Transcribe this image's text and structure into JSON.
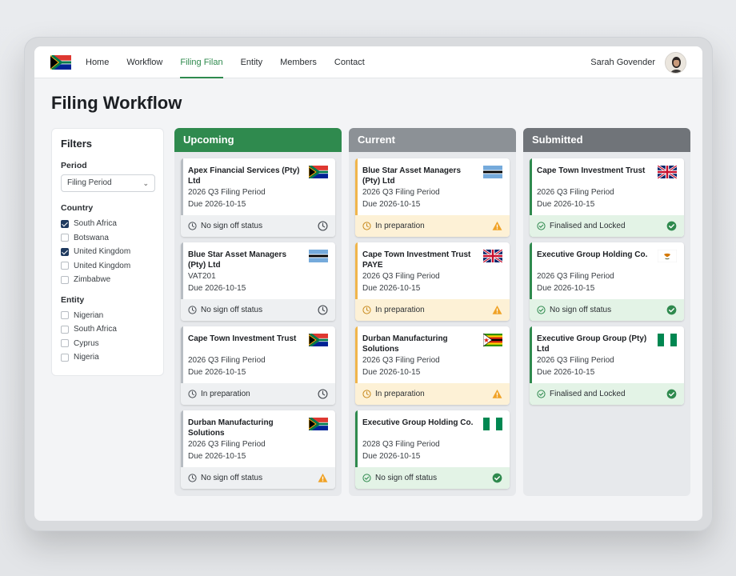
{
  "nav": {
    "items": [
      {
        "label": "Home",
        "active": false
      },
      {
        "label": "Workflow",
        "active": false
      },
      {
        "label": "Filing Filan",
        "active": true
      },
      {
        "label": "Entity",
        "active": false
      },
      {
        "label": "Members",
        "active": false
      },
      {
        "label": "Contact",
        "active": false
      }
    ],
    "user_name": "Sarah Govender"
  },
  "page_title": "Filing Workflow",
  "filters": {
    "title": "Filters",
    "period_label": "Period",
    "period_value": "Filing Period",
    "country_label": "Country",
    "countries": [
      {
        "label": "South Africa",
        "checked": true
      },
      {
        "label": "Botswana",
        "checked": false
      },
      {
        "label": "United Kingdom",
        "checked": true
      },
      {
        "label": "United Kingdom",
        "checked": false
      },
      {
        "label": "Zimbabwe",
        "checked": false
      }
    ],
    "entity_label": "Entity",
    "entities": [
      {
        "label": "Nigerian",
        "checked": false
      },
      {
        "label": "South Africa",
        "checked": false
      },
      {
        "label": "Cyprus",
        "checked": false
      },
      {
        "label": "Nigeria",
        "checked": false
      }
    ]
  },
  "colors": {
    "upcoming": "#2f8a4e",
    "current": "#8c9196",
    "submitted": "#707479",
    "neutral_status": "#eef0f2",
    "warning_status": "#fdf1d6",
    "success_status": "#e3f3e6",
    "warning_bar": "#f0b54b",
    "success_bar": "#2f8a4e",
    "neutral_bar": "#b8bdc3"
  },
  "columns": [
    {
      "title": "Upcoming",
      "color": "#2f8a4e",
      "cards": [
        {
          "name": "Apex Financial Services (Pty) Ltd",
          "lines": [
            "2026 Q3 Filing Period",
            "Due 2026-10-15"
          ],
          "flag": "south-africa",
          "status": "No sign off status",
          "tone": "neutral",
          "right_icon": "clock"
        },
        {
          "name": "Blue Star Asset Managers (Pty) Ltd",
          "lines": [
            "VAT201",
            "Due 2026-10-15"
          ],
          "flag": "botswana",
          "status": "No sign off status",
          "tone": "neutral",
          "right_icon": "clock"
        },
        {
          "name": "Cape Town Investment Trust",
          "lines": [
            "2026 Q3 Filing Period",
            "Due 2026-10-15"
          ],
          "flag": "south-africa",
          "status": "In preparation",
          "tone": "neutral",
          "right_icon": "clock"
        },
        {
          "name": "Durban Manufacturing Solutions",
          "lines": [
            "2026 Q3 Filing Period",
            "Due 2026-10-15"
          ],
          "flag": "south-africa",
          "status": "No sign off status",
          "tone": "neutral",
          "right_icon": "warning"
        }
      ]
    },
    {
      "title": "Current",
      "color": "#8c9196",
      "cards": [
        {
          "name": "Blue Star Asset Managers (Pty) Ltd",
          "lines": [
            "2026 Q3 Filing Period",
            "Due 2026-10-15"
          ],
          "flag": "botswana",
          "status": "In preparation",
          "tone": "warning",
          "right_icon": "warning"
        },
        {
          "name": "Cape Town Investment Trust PAYE",
          "lines": [
            "2026 Q3 Filing Period",
            "Due 2026-10-15"
          ],
          "flag": "united-kingdom",
          "status": "In preparation",
          "tone": "warning",
          "right_icon": "warning"
        },
        {
          "name": "Durban Manufacturing Solutions",
          "lines": [
            "2026 Q3 Filing Period",
            "Due 2026-10-15"
          ],
          "flag": "zimbabwe",
          "status": "In preparation",
          "tone": "warning",
          "right_icon": "warning"
        },
        {
          "name": "Executive Group Holding Co.",
          "lines": [
            "2028 Q3 Filing Period",
            "Due 2026-10-15"
          ],
          "flag": "nigeria",
          "status": "No sign off status",
          "tone": "success",
          "right_icon": "check"
        }
      ]
    },
    {
      "title": "Submitted",
      "color": "#707479",
      "cards": [
        {
          "name": "Cape Town Investment Trust",
          "lines": [
            "2026 Q3 Filing Period",
            "Due 2026-10-15"
          ],
          "flag": "united-kingdom",
          "status": "Finalised and Locked",
          "tone": "success",
          "right_icon": "check"
        },
        {
          "name": "Executive Group Holding Co.",
          "lines": [
            "2026 Q3 Filing Period",
            "Due 2026-10-15"
          ],
          "flag": "cyprus",
          "status": "No sign off status",
          "tone": "success",
          "right_icon": "check"
        },
        {
          "name": "Executive Group Group (Pty) Ltd",
          "lines": [
            "2026 Q3 Filing Period",
            "Due 2026-10-15"
          ],
          "flag": "nigeria",
          "status": "Finalised and Locked",
          "tone": "success",
          "right_icon": "check"
        }
      ]
    }
  ]
}
